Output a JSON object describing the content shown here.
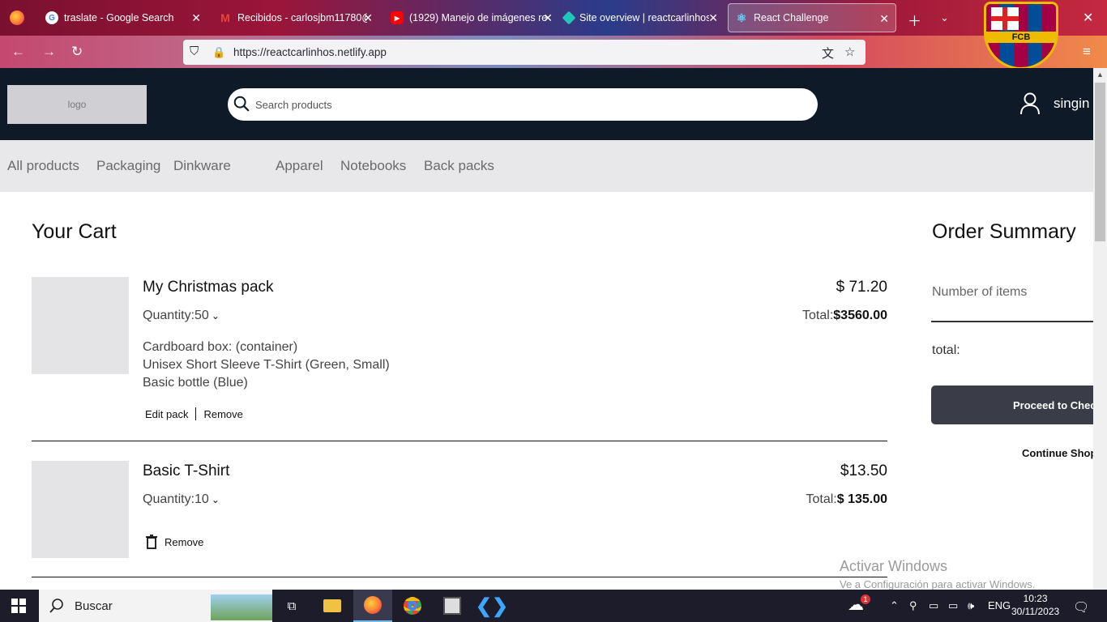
{
  "browser": {
    "tabs": [
      {
        "title": "traslate - Google Search",
        "favicon": "google-icon"
      },
      {
        "title": "Recibidos - carlosjbm11780@",
        "favicon": "gmail-icon"
      },
      {
        "title": "(1929) Manejo de imágenes re",
        "favicon": "youtube-icon"
      },
      {
        "title": "Site overview | reactcarlinhos",
        "favicon": "netlify-icon"
      },
      {
        "title": "React Challenge",
        "favicon": "react-icon",
        "active": true
      }
    ],
    "url": "https://reactcarlinhos.netlify.app",
    "crest_text": "FCB"
  },
  "header": {
    "logo_text": "logo",
    "search_placeholder": "Search products",
    "signin_label": "singin"
  },
  "categories": [
    "All products",
    "Packaging",
    "Dinkware",
    "Apparel",
    "Notebooks",
    "Back packs"
  ],
  "cart": {
    "title": "Your Cart",
    "items": [
      {
        "name": "My Christmas pack",
        "quantity": "Quantity:50",
        "price": "$ 71.20",
        "total_label": "Total:",
        "total_value": "$3560.00",
        "contents": [
          "Cardboard box: (container)",
          "Unisex Short Sleeve T-Shirt (Green, Small)",
          "Basic bottle (Blue)"
        ],
        "edit_label": "Edit pack",
        "remove_label": "Remove"
      },
      {
        "name": "Basic T-Shirt",
        "quantity": "Quantity:10",
        "price": "$13.50",
        "total_label": "Total:",
        "total_value": "$ 135.00",
        "remove_label": "Remove"
      }
    ]
  },
  "summary": {
    "title": "Order Summary",
    "items_label": "Number of items",
    "total_label": "total:",
    "checkout_label": "Proceed to Checkout",
    "continue_label": "Continue Shopping"
  },
  "watermark": {
    "line1": "Activar Windows",
    "line2": "Ve a Configuración para activar Windows."
  },
  "taskbar": {
    "search_label": "Buscar",
    "language": "ENG",
    "time": "10:23",
    "date": "30/11/2023",
    "notification_count": "1"
  },
  "colors": {
    "header_bg": "#0f1a29",
    "category_bg": "#e8e8ea",
    "checkout_bg": "#3a3d47"
  }
}
